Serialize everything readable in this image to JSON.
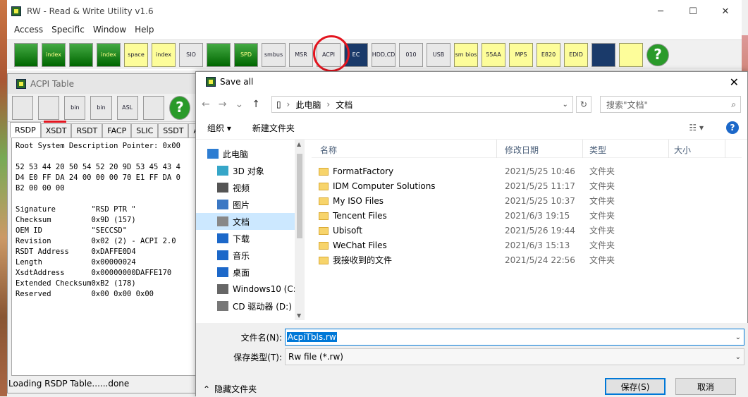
{
  "app": {
    "title": "RW - Read & Write Utility v1.6",
    "menu": [
      "Access",
      "Specific",
      "Window",
      "Help"
    ],
    "toolbar": [
      "",
      "index",
      "",
      "index",
      "space",
      "index",
      "SIO",
      "",
      "SPD",
      "smbus",
      "MSR",
      "ACPI",
      "EC",
      "HDD,CD",
      "010",
      "USB",
      "sm bios",
      "55AA",
      "MPS",
      "E820",
      "EDID",
      "",
      "",
      "?"
    ]
  },
  "acpi_window": {
    "title": "ACPI Table",
    "buttons": [
      "",
      "",
      "bin",
      "bin",
      "ASL",
      "",
      "?"
    ],
    "tabs": [
      "RSDP",
      "XSDT",
      "RSDT",
      "FACP",
      "SLIC",
      "SSDT",
      "A"
    ],
    "dump": "Root System Description Pointer: 0x00\n\n52 53 44 20 50 54 52 20 9D 53 45 43 4\nD4 E0 FF DA 24 00 00 00 70 E1 FF DA 0\nB2 00 00 00\n\nSignature        \"RSD PTR \"\nChecksum         0x9D (157)\nOEM ID           \"SECCSD\"\nRevision         0x02 (2) - ACPI 2.0\nRSDT Address     0xDAFFE0D4\nLength           0x00000024\nXsdtAddress      0x00000000DAFFE170\nExtended Checksum0xB2 (178)\nReserved         0x00 0x00 0x00",
    "status": "Loading RSDP Table......done"
  },
  "save_dialog": {
    "title": "Save all",
    "path": [
      "此电脑",
      "文档"
    ],
    "search_placeholder": "搜索\"文档\"",
    "organize": "组织 ▾",
    "new_folder": "新建文件夹",
    "tree": [
      {
        "label": "此电脑",
        "sub": false,
        "sel": false
      },
      {
        "label": "3D 对象",
        "sub": true,
        "sel": false
      },
      {
        "label": "视频",
        "sub": true,
        "sel": false
      },
      {
        "label": "图片",
        "sub": true,
        "sel": false
      },
      {
        "label": "文档",
        "sub": true,
        "sel": true
      },
      {
        "label": "下载",
        "sub": true,
        "sel": false
      },
      {
        "label": "音乐",
        "sub": true,
        "sel": false
      },
      {
        "label": "桌面",
        "sub": true,
        "sel": false
      },
      {
        "label": "Windows10 (C:",
        "sub": true,
        "sel": false
      },
      {
        "label": "CD 驱动器 (D:)",
        "sub": true,
        "sel": false
      }
    ],
    "columns": [
      "名称",
      "修改日期",
      "类型",
      "大小"
    ],
    "files": [
      {
        "name": "FormatFactory",
        "date": "2021/5/25 10:46",
        "type": "文件夹"
      },
      {
        "name": "IDM Computer Solutions",
        "date": "2021/5/25 11:17",
        "type": "文件夹"
      },
      {
        "name": "My ISO Files",
        "date": "2021/5/25 10:37",
        "type": "文件夹"
      },
      {
        "name": "Tencent Files",
        "date": "2021/6/3 19:15",
        "type": "文件夹"
      },
      {
        "name": "Ubisoft",
        "date": "2021/5/26 19:44",
        "type": "文件夹"
      },
      {
        "name": "WeChat Files",
        "date": "2021/6/3 15:13",
        "type": "文件夹"
      },
      {
        "name": "我接收到的文件",
        "date": "2021/5/24 22:56",
        "type": "文件夹"
      }
    ],
    "filename_label": "文件名(N):",
    "filename_value": "AcpiTbls.rw",
    "filetype_label": "保存类型(T):",
    "filetype_value": "Rw file (*.rw)",
    "hide_folders": "隐藏文件夹",
    "save_btn": "保存(S)",
    "cancel_btn": "取消"
  }
}
